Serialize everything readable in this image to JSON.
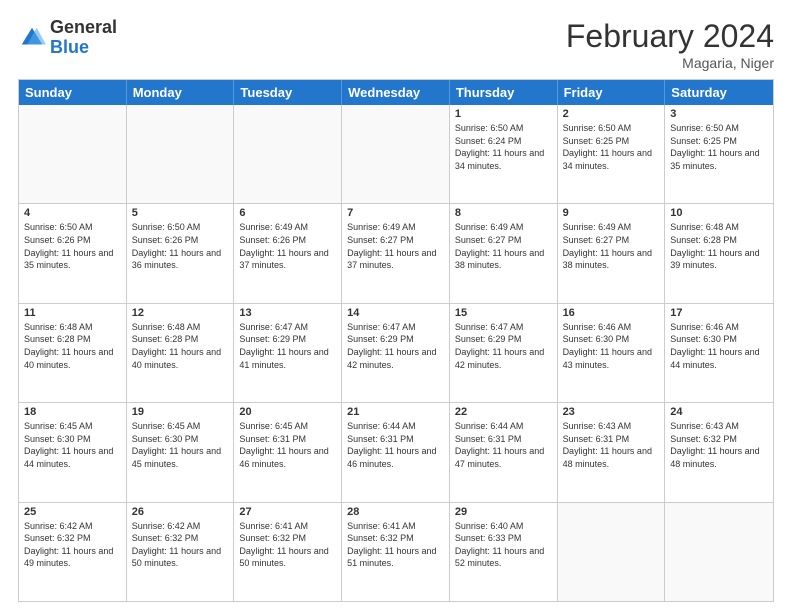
{
  "header": {
    "logo_general": "General",
    "logo_blue": "Blue",
    "month_title": "February 2024",
    "location": "Magaria, Niger"
  },
  "days_of_week": [
    "Sunday",
    "Monday",
    "Tuesday",
    "Wednesday",
    "Thursday",
    "Friday",
    "Saturday"
  ],
  "weeks": [
    [
      {
        "day": "",
        "info": ""
      },
      {
        "day": "",
        "info": ""
      },
      {
        "day": "",
        "info": ""
      },
      {
        "day": "",
        "info": ""
      },
      {
        "day": "1",
        "info": "Sunrise: 6:50 AM\nSunset: 6:24 PM\nDaylight: 11 hours and 34 minutes."
      },
      {
        "day": "2",
        "info": "Sunrise: 6:50 AM\nSunset: 6:25 PM\nDaylight: 11 hours and 34 minutes."
      },
      {
        "day": "3",
        "info": "Sunrise: 6:50 AM\nSunset: 6:25 PM\nDaylight: 11 hours and 35 minutes."
      }
    ],
    [
      {
        "day": "4",
        "info": "Sunrise: 6:50 AM\nSunset: 6:26 PM\nDaylight: 11 hours and 35 minutes."
      },
      {
        "day": "5",
        "info": "Sunrise: 6:50 AM\nSunset: 6:26 PM\nDaylight: 11 hours and 36 minutes."
      },
      {
        "day": "6",
        "info": "Sunrise: 6:49 AM\nSunset: 6:26 PM\nDaylight: 11 hours and 37 minutes."
      },
      {
        "day": "7",
        "info": "Sunrise: 6:49 AM\nSunset: 6:27 PM\nDaylight: 11 hours and 37 minutes."
      },
      {
        "day": "8",
        "info": "Sunrise: 6:49 AM\nSunset: 6:27 PM\nDaylight: 11 hours and 38 minutes."
      },
      {
        "day": "9",
        "info": "Sunrise: 6:49 AM\nSunset: 6:27 PM\nDaylight: 11 hours and 38 minutes."
      },
      {
        "day": "10",
        "info": "Sunrise: 6:48 AM\nSunset: 6:28 PM\nDaylight: 11 hours and 39 minutes."
      }
    ],
    [
      {
        "day": "11",
        "info": "Sunrise: 6:48 AM\nSunset: 6:28 PM\nDaylight: 11 hours and 40 minutes."
      },
      {
        "day": "12",
        "info": "Sunrise: 6:48 AM\nSunset: 6:28 PM\nDaylight: 11 hours and 40 minutes."
      },
      {
        "day": "13",
        "info": "Sunrise: 6:47 AM\nSunset: 6:29 PM\nDaylight: 11 hours and 41 minutes."
      },
      {
        "day": "14",
        "info": "Sunrise: 6:47 AM\nSunset: 6:29 PM\nDaylight: 11 hours and 42 minutes."
      },
      {
        "day": "15",
        "info": "Sunrise: 6:47 AM\nSunset: 6:29 PM\nDaylight: 11 hours and 42 minutes."
      },
      {
        "day": "16",
        "info": "Sunrise: 6:46 AM\nSunset: 6:30 PM\nDaylight: 11 hours and 43 minutes."
      },
      {
        "day": "17",
        "info": "Sunrise: 6:46 AM\nSunset: 6:30 PM\nDaylight: 11 hours and 44 minutes."
      }
    ],
    [
      {
        "day": "18",
        "info": "Sunrise: 6:45 AM\nSunset: 6:30 PM\nDaylight: 11 hours and 44 minutes."
      },
      {
        "day": "19",
        "info": "Sunrise: 6:45 AM\nSunset: 6:30 PM\nDaylight: 11 hours and 45 minutes."
      },
      {
        "day": "20",
        "info": "Sunrise: 6:45 AM\nSunset: 6:31 PM\nDaylight: 11 hours and 46 minutes."
      },
      {
        "day": "21",
        "info": "Sunrise: 6:44 AM\nSunset: 6:31 PM\nDaylight: 11 hours and 46 minutes."
      },
      {
        "day": "22",
        "info": "Sunrise: 6:44 AM\nSunset: 6:31 PM\nDaylight: 11 hours and 47 minutes."
      },
      {
        "day": "23",
        "info": "Sunrise: 6:43 AM\nSunset: 6:31 PM\nDaylight: 11 hours and 48 minutes."
      },
      {
        "day": "24",
        "info": "Sunrise: 6:43 AM\nSunset: 6:32 PM\nDaylight: 11 hours and 48 minutes."
      }
    ],
    [
      {
        "day": "25",
        "info": "Sunrise: 6:42 AM\nSunset: 6:32 PM\nDaylight: 11 hours and 49 minutes."
      },
      {
        "day": "26",
        "info": "Sunrise: 6:42 AM\nSunset: 6:32 PM\nDaylight: 11 hours and 50 minutes."
      },
      {
        "day": "27",
        "info": "Sunrise: 6:41 AM\nSunset: 6:32 PM\nDaylight: 11 hours and 50 minutes."
      },
      {
        "day": "28",
        "info": "Sunrise: 6:41 AM\nSunset: 6:32 PM\nDaylight: 11 hours and 51 minutes."
      },
      {
        "day": "29",
        "info": "Sunrise: 6:40 AM\nSunset: 6:33 PM\nDaylight: 11 hours and 52 minutes."
      },
      {
        "day": "",
        "info": ""
      },
      {
        "day": "",
        "info": ""
      }
    ]
  ]
}
